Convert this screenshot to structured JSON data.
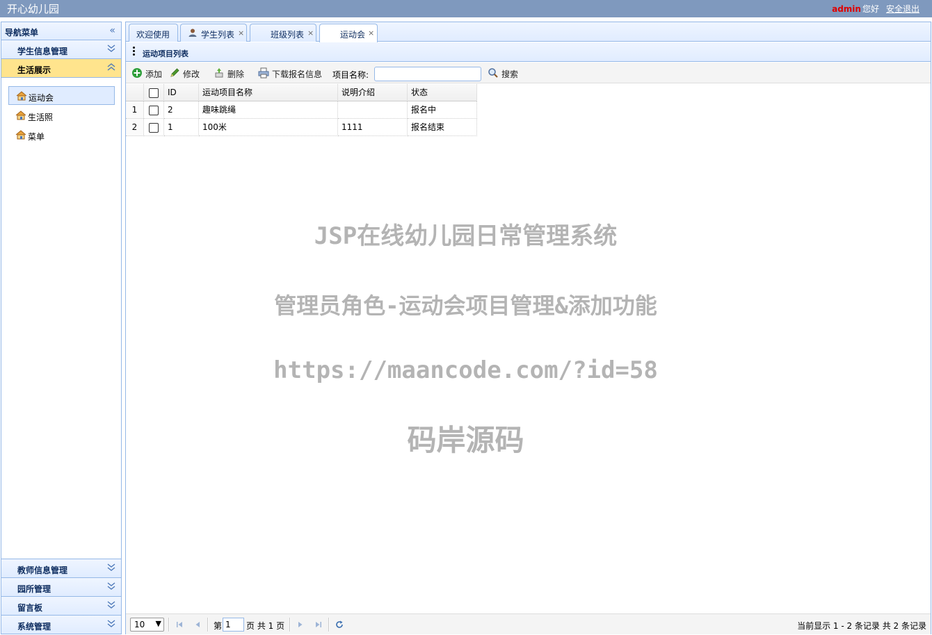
{
  "header": {
    "app_title": "开心幼儿园",
    "user_name": "admin",
    "greeting": "您好",
    "logout": "安全退出"
  },
  "sidebar": {
    "title": "导航菜单",
    "top_sections": [
      {
        "label": "学生信息管理"
      },
      {
        "label": "生活展示"
      }
    ],
    "items": [
      {
        "label": "运动会"
      },
      {
        "label": "生活照"
      },
      {
        "label": "菜单"
      }
    ],
    "bottom_sections": [
      {
        "label": "教师信息管理"
      },
      {
        "label": "园所管理"
      },
      {
        "label": "留言板"
      },
      {
        "label": "系统管理"
      }
    ]
  },
  "tabs": [
    {
      "label": "欢迎使用",
      "closable": false
    },
    {
      "label": "学生列表",
      "closable": true
    },
    {
      "label": "班级列表",
      "closable": true
    },
    {
      "label": "运动会",
      "closable": true
    }
  ],
  "panel": {
    "title": "运动项目列表"
  },
  "toolbar": {
    "add": "添加",
    "edit": "修改",
    "delete": "删除",
    "download": "下载报名信息",
    "search_label": "项目名称:",
    "search_value": "",
    "search_button": "搜索"
  },
  "table": {
    "columns": [
      "ID",
      "运动项目名称",
      "说明介绍",
      "状态"
    ],
    "rows": [
      {
        "num": "1",
        "id": "2",
        "name": "趣味跳绳",
        "desc": "",
        "status": "报名中"
      },
      {
        "num": "2",
        "id": "1",
        "name": "100米",
        "desc": "1111",
        "status": "报名结束"
      }
    ]
  },
  "watermark": {
    "line1": "JSP在线幼儿园日常管理系统",
    "line2": "管理员角色-运动会项目管理&添加功能",
    "line3": "https://maancode.com/?id=58",
    "line4": "码岸源码"
  },
  "pager": {
    "page_size": "10",
    "page_prefix": "第",
    "page_value": "1",
    "page_suffix": "页 共 1 页",
    "info": "当前显示 1 - 2 条记录 共 2 条记录"
  }
}
